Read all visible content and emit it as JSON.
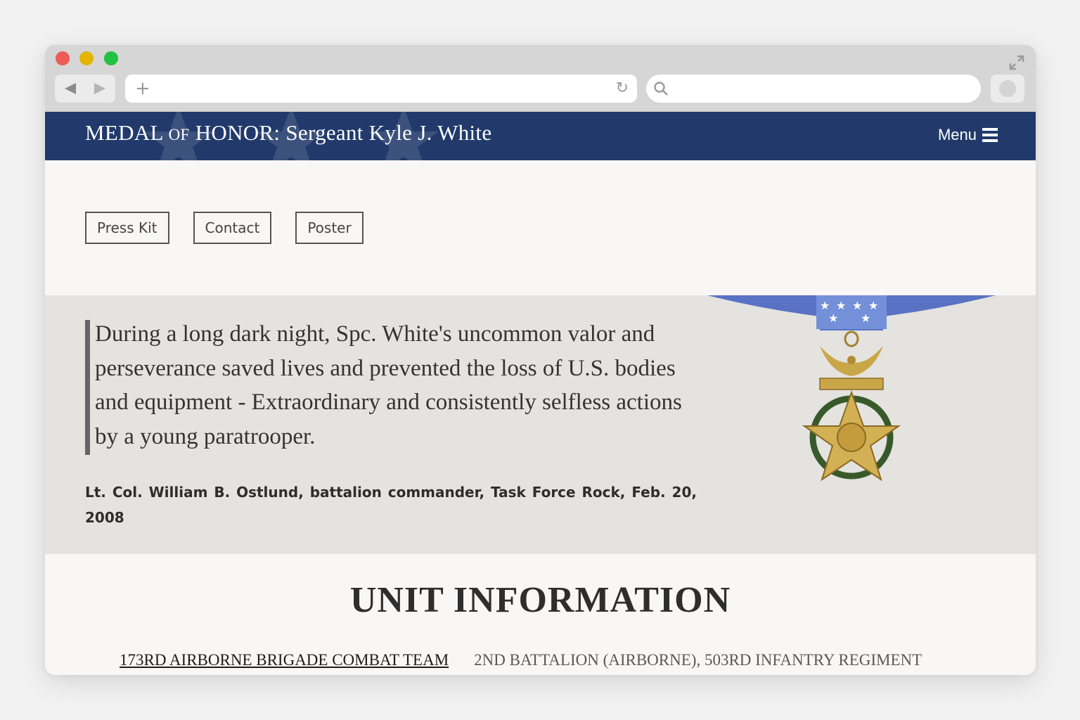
{
  "browser": {
    "address_value": "",
    "search_value": ""
  },
  "header": {
    "title_word1": "MEDAL",
    "title_of": "OF",
    "title_rest": "HONOR: Sergeant Kyle J. White",
    "menu_label": "Menu"
  },
  "buttons": [
    {
      "label": "Press Kit"
    },
    {
      "label": "Contact"
    },
    {
      "label": "Poster"
    }
  ],
  "quote": {
    "text": "During a long dark night, Spc. White's uncommon valor and perseverance saved lives and prevented the loss of U.S. bodies and equipment - Extraordinary and consistently selfless actions by a young paratrooper.",
    "attribution": "Lt. Col. William B. Ostlund, battalion commander, Task Force Rock, Feb. 20, 2008"
  },
  "unit": {
    "heading": "UNIT INFORMATION",
    "links": [
      {
        "label": "173RD AIRBORNE BRIGADE COMBAT TEAM"
      },
      {
        "label": "2ND BATTALION (AIRBORNE), 503RD INFANTRY REGIMENT"
      }
    ]
  },
  "colors": {
    "header_bg": "#213a6b",
    "quote_band_bg": "#e4e3df",
    "page_bg": "#f8f7f5"
  }
}
